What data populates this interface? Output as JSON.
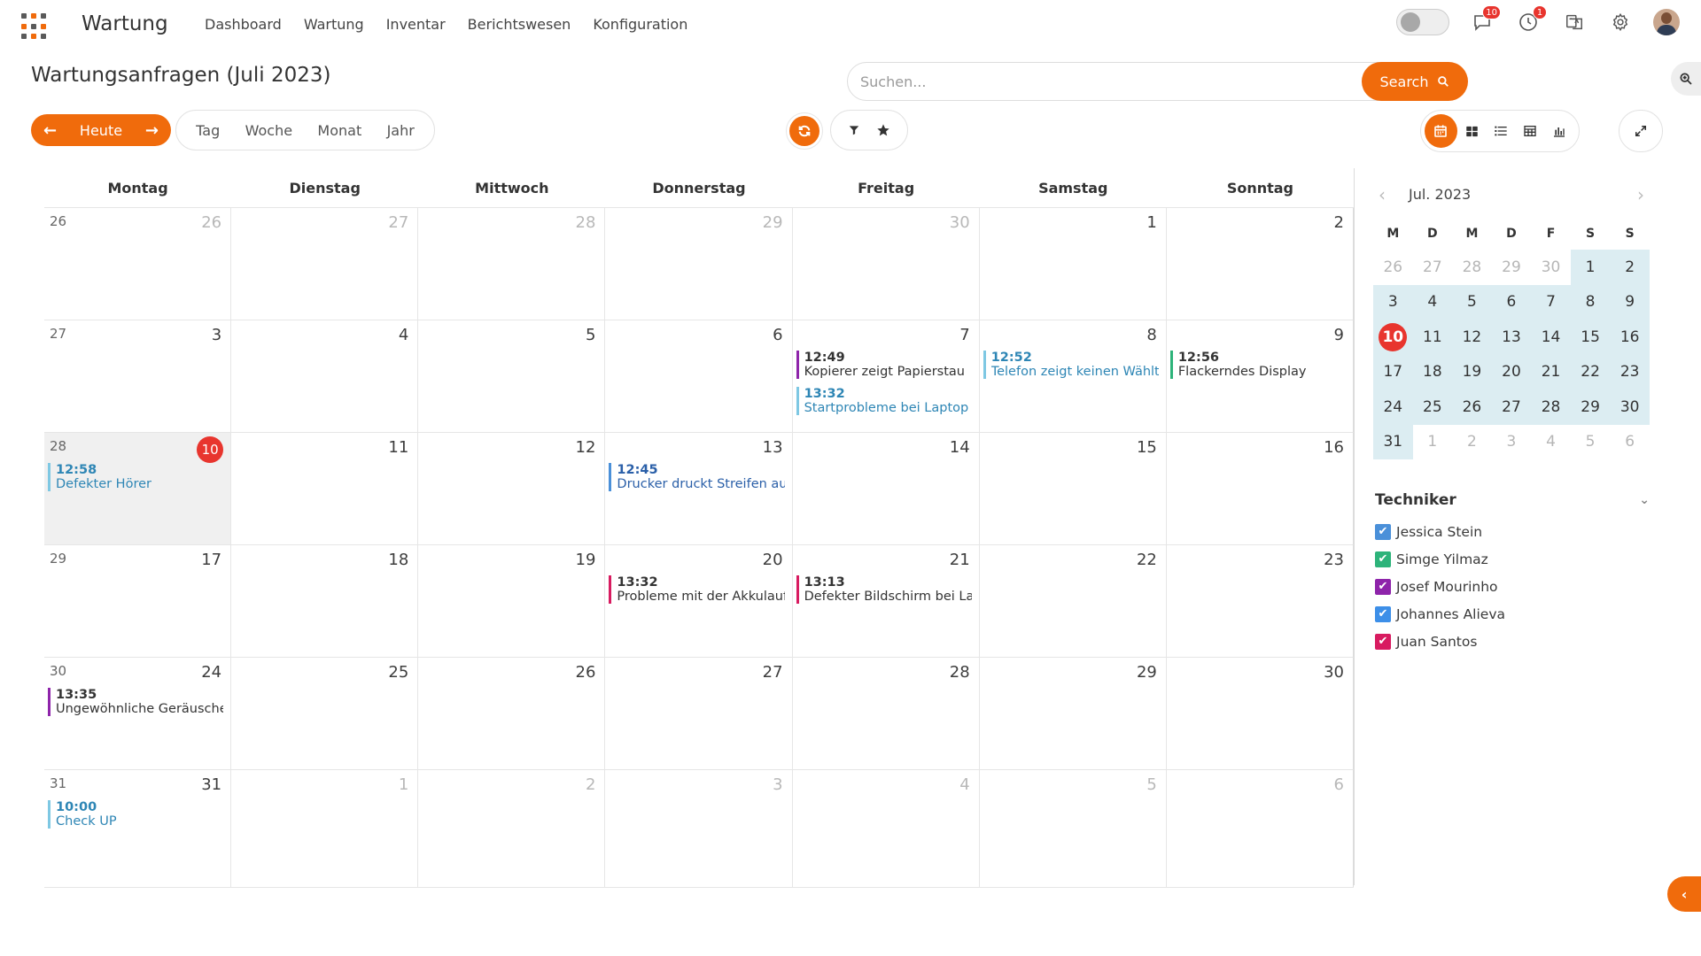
{
  "app": {
    "title": "Wartung"
  },
  "nav": [
    "Dashboard",
    "Wartung",
    "Inventar",
    "Berichtswesen",
    "Konfiguration"
  ],
  "topbar": {
    "messages_badge": "10",
    "activity_badge": "1"
  },
  "page": {
    "title": "Wartungsanfragen (Juli 2023)"
  },
  "search": {
    "placeholder": "Suchen...",
    "button": "Search"
  },
  "toolbar": {
    "today": "Heute",
    "ranges": [
      "Tag",
      "Woche",
      "Monat",
      "Jahr"
    ]
  },
  "weekdays": [
    "Montag",
    "Dienstag",
    "Mittwoch",
    "Donnerstag",
    "Freitag",
    "Samstag",
    "Sonntag"
  ],
  "colors": {
    "accent": "#f06b0c",
    "today": "#e8352e",
    "mini_range": "#dcedf2"
  },
  "weeks": [
    {
      "week": "26",
      "days": [
        {
          "d": "26",
          "o": true
        },
        {
          "d": "27",
          "o": true
        },
        {
          "d": "28",
          "o": true
        },
        {
          "d": "29",
          "o": true
        },
        {
          "d": "30",
          "o": true
        },
        {
          "d": "1"
        },
        {
          "d": "2"
        }
      ]
    },
    {
      "week": "27",
      "days": [
        {
          "d": "3"
        },
        {
          "d": "4"
        },
        {
          "d": "5"
        },
        {
          "d": "6"
        },
        {
          "d": "7",
          "events": [
            {
              "time": "12:49",
              "title": "Kopierer zeigt Papierstau",
              "color": "#8e24aa",
              "text": "#333333"
            },
            {
              "time": "13:32",
              "title": "Startprobleme bei Laptop",
              "color": "#7ec8e3",
              "text": "#2e86b5"
            }
          ]
        },
        {
          "d": "8",
          "events": [
            {
              "time": "12:52",
              "title": "Telefon zeigt keinen Wählton",
              "color": "#7ec8e3",
              "text": "#2e86b5"
            }
          ]
        },
        {
          "d": "9",
          "events": [
            {
              "time": "12:56",
              "title": "Flackerndes Display",
              "color": "#2db37a",
              "text": "#333333"
            }
          ]
        }
      ]
    },
    {
      "week": "28",
      "days": [
        {
          "d": "10",
          "today": true,
          "events": [
            {
              "time": "12:58",
              "title": "Defekter Hörer",
              "color": "#7ec8e3",
              "text": "#2e86b5"
            }
          ]
        },
        {
          "d": "11"
        },
        {
          "d": "12"
        },
        {
          "d": "13",
          "events": [
            {
              "time": "12:45",
              "title": "Drucker druckt Streifen auf Papier",
              "color": "#4a90d9",
              "text": "#2a5fa8"
            }
          ]
        },
        {
          "d": "14"
        },
        {
          "d": "15"
        },
        {
          "d": "16"
        }
      ]
    },
    {
      "week": "29",
      "days": [
        {
          "d": "17"
        },
        {
          "d": "18"
        },
        {
          "d": "19"
        },
        {
          "d": "20",
          "events": [
            {
              "time": "13:32",
              "title": "Probleme mit der Akkulaufzeit",
              "color": "#d81b60",
              "text": "#333333"
            }
          ]
        },
        {
          "d": "21",
          "events": [
            {
              "time": "13:13",
              "title": "Defekter Bildschirm bei Laptop",
              "color": "#d81b60",
              "text": "#333333"
            }
          ]
        },
        {
          "d": "22"
        },
        {
          "d": "23"
        }
      ]
    },
    {
      "week": "30",
      "days": [
        {
          "d": "24",
          "events": [
            {
              "time": "13:35",
              "title": "Ungewöhnliche Geräusche",
              "color": "#8e24aa",
              "text": "#333333"
            }
          ]
        },
        {
          "d": "25"
        },
        {
          "d": "26"
        },
        {
          "d": "27"
        },
        {
          "d": "28"
        },
        {
          "d": "29"
        },
        {
          "d": "30"
        }
      ]
    },
    {
      "week": "31",
      "days": [
        {
          "d": "31",
          "events": [
            {
              "time": "10:00",
              "title": "Check UP",
              "color": "#7ec8e3",
              "text": "#2e86b5"
            }
          ]
        },
        {
          "d": "1",
          "o": true
        },
        {
          "d": "2",
          "o": true
        },
        {
          "d": "3",
          "o": true
        },
        {
          "d": "4",
          "o": true
        },
        {
          "d": "5",
          "o": true
        },
        {
          "d": "6",
          "o": true
        }
      ]
    }
  ],
  "mini_calendar": {
    "label": "Jul. 2023",
    "day_heads": [
      "M",
      "D",
      "M",
      "D",
      "F",
      "S",
      "S"
    ],
    "days": [
      {
        "d": "26",
        "s": "out"
      },
      {
        "d": "27",
        "s": "out"
      },
      {
        "d": "28",
        "s": "out"
      },
      {
        "d": "29",
        "s": "out"
      },
      {
        "d": "30",
        "s": "out"
      },
      {
        "d": "1",
        "s": "in"
      },
      {
        "d": "2",
        "s": "in"
      },
      {
        "d": "3",
        "s": "in"
      },
      {
        "d": "4",
        "s": "in"
      },
      {
        "d": "5",
        "s": "in"
      },
      {
        "d": "6",
        "s": "in"
      },
      {
        "d": "7",
        "s": "in"
      },
      {
        "d": "8",
        "s": "in"
      },
      {
        "d": "9",
        "s": "in"
      },
      {
        "d": "10",
        "s": "today"
      },
      {
        "d": "11",
        "s": "in"
      },
      {
        "d": "12",
        "s": "in"
      },
      {
        "d": "13",
        "s": "in"
      },
      {
        "d": "14",
        "s": "in"
      },
      {
        "d": "15",
        "s": "in"
      },
      {
        "d": "16",
        "s": "in"
      },
      {
        "d": "17",
        "s": "in"
      },
      {
        "d": "18",
        "s": "in"
      },
      {
        "d": "19",
        "s": "in"
      },
      {
        "d": "20",
        "s": "in"
      },
      {
        "d": "21",
        "s": "in"
      },
      {
        "d": "22",
        "s": "in"
      },
      {
        "d": "23",
        "s": "in"
      },
      {
        "d": "24",
        "s": "in"
      },
      {
        "d": "25",
        "s": "in"
      },
      {
        "d": "26",
        "s": "in"
      },
      {
        "d": "27",
        "s": "in"
      },
      {
        "d": "28",
        "s": "in"
      },
      {
        "d": "29",
        "s": "in"
      },
      {
        "d": "30",
        "s": "in"
      },
      {
        "d": "31",
        "s": "in"
      },
      {
        "d": "1",
        "s": "out"
      },
      {
        "d": "2",
        "s": "out"
      },
      {
        "d": "3",
        "s": "out"
      },
      {
        "d": "4",
        "s": "out"
      },
      {
        "d": "5",
        "s": "out"
      },
      {
        "d": "6",
        "s": "out"
      }
    ]
  },
  "technicians": {
    "title": "Techniker",
    "items": [
      {
        "name": "Jessica Stein",
        "color": "#4a90d9",
        "checked": true
      },
      {
        "name": "Simge Yilmaz",
        "color": "#2db37a",
        "checked": true
      },
      {
        "name": "Josef Mourinho",
        "color": "#8e24aa",
        "checked": true
      },
      {
        "name": "Johannes Alieva",
        "color": "#3d8fe8",
        "checked": true
      },
      {
        "name": "Juan Santos",
        "color": "#d81b60",
        "checked": true
      }
    ]
  }
}
